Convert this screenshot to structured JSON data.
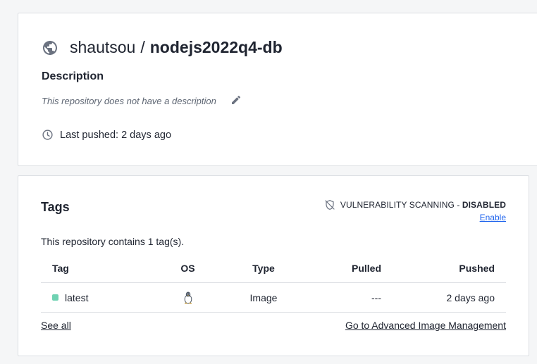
{
  "repo": {
    "namespace": "shautsou",
    "separator": "/",
    "name": "nodejs2022q4-db",
    "description_heading": "Description",
    "description_text": "This repository does not have a description",
    "last_pushed": "Last pushed: 2 days ago"
  },
  "tags_section": {
    "heading": "Tags",
    "vuln_label": "VULNERABILITY SCANNING - ",
    "vuln_status": "DISABLED",
    "enable_label": "Enable",
    "tag_count_text": "This repository contains 1 tag(s).",
    "columns": [
      "Tag",
      "OS",
      "Type",
      "Pulled",
      "Pushed"
    ],
    "rows": [
      {
        "tag": "latest",
        "os": "linux-icon",
        "type": "Image",
        "pulled": "---",
        "pushed": "2 days ago"
      }
    ],
    "see_all_label": "See all",
    "advanced_label": "Go to Advanced Image Management"
  },
  "icons": {
    "visibility": "globe-icon",
    "edit": "pencil-icon",
    "time": "clock-icon",
    "scan": "shield-off-icon"
  },
  "colors": {
    "tag_dot": "#6fd2b2",
    "link_blue": "#1d63ed"
  }
}
